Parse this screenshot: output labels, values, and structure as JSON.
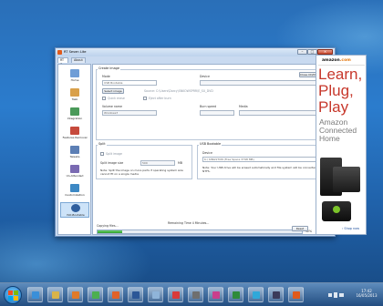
{
  "window": {
    "title": "RT Seven Lite"
  },
  "tabs": [
    "RT 7 Lite",
    "About"
  ],
  "sidebar": {
    "items": [
      {
        "label": "Home",
        "icon": "home-icon",
        "color": "#6f9dd6"
      },
      {
        "label": "Task",
        "icon": "task-icon",
        "color": "#d9a04a"
      },
      {
        "label": "Integration",
        "icon": "integration-icon",
        "color": "#4a9a5a"
      },
      {
        "label": "Features Removal",
        "icon": "features-removal-icon",
        "color": "#c64a3c"
      },
      {
        "label": "Tweaks",
        "icon": "tweaks-icon",
        "color": "#5c7fb5"
      },
      {
        "label": "Un-Attended",
        "icon": "unattended-icon",
        "color": "#7a6ab2"
      },
      {
        "label": "Customization",
        "icon": "customization-icon",
        "color": "#3d88c4"
      },
      {
        "label": "ISO-Bootable",
        "icon": "iso-bootable-icon",
        "color": "#2f5f9e"
      }
    ]
  },
  "create_image": {
    "title": "Create image",
    "mode_label": "Mode",
    "mode_value": "USB Bootable",
    "device_label": "Device",
    "device_value": "",
    "close_button": "Close CD/DVD Drive",
    "select_button": "Select image",
    "source_text": "Source: C:\\Users\\Darcy\\SNKOWSPRR\\E_SU_DVD",
    "quick_erase": "Quick erase",
    "eject_after_burn": "Eject after burn",
    "volume_name_label": "Volume name",
    "volume_name_value": "Windows7",
    "burn_speed_label": "Burn speed",
    "media_label": "Media"
  },
  "split": {
    "title": "Split",
    "split_image": "Split image",
    "size_label": "Split image size",
    "size_value": "500",
    "size_unit": "MB",
    "note": "Note: Split the image on more parts if operating system size cannot fit on a single media"
  },
  "usb": {
    "title": "USB Bootable",
    "device_label": "Device",
    "device_value": "K:\\ KINGSTON (Free Space 3798 MB)",
    "note": "Note: Your USB drive will be erased automatically and file system will be converted to NTFS."
  },
  "progress": {
    "label": "Copying files...",
    "percent_text": "12%",
    "fraction": 0.12,
    "remaining": "Remaining Time 4 Minutes...",
    "usb_button": "USB",
    "reset_button": "Reset"
  },
  "ad": {
    "logo_main": "amazon",
    "logo_suffix": ".com",
    "headline": "Learn, Plug, Play",
    "subline": "Amazon Connected Home",
    "shop": "› Shop now",
    "accent": "#c7382c"
  },
  "taskbar": {
    "apps": [
      {
        "icon": "ie-icon",
        "color": "#3a8fd9"
      },
      {
        "icon": "explorer-icon",
        "color": "#d9b34a"
      },
      {
        "icon": "media-player-icon",
        "color": "#e07a2a"
      },
      {
        "icon": "chrome-icon",
        "color": "#4caf50"
      },
      {
        "icon": "firefox-icon",
        "color": "#e0622a"
      },
      {
        "icon": "word-icon",
        "color": "#2b5797"
      },
      {
        "icon": "paint-icon",
        "color": "#8fb4d9"
      },
      {
        "icon": "mail-icon",
        "color": "#d93a3a"
      },
      {
        "icon": "calculator-icon",
        "color": "#6f6f6f"
      },
      {
        "icon": "network-icon",
        "color": "#c93f8c"
      },
      {
        "icon": "excel-icon",
        "color": "#2e8b3a"
      },
      {
        "icon": "skype-icon",
        "color": "#2fa8d9"
      },
      {
        "icon": "steam-icon",
        "color": "#3b3b5a"
      },
      {
        "icon": "rt7lite-icon",
        "color": "#e05a1c"
      }
    ],
    "time": "17:42",
    "date": "16/05/2013"
  }
}
